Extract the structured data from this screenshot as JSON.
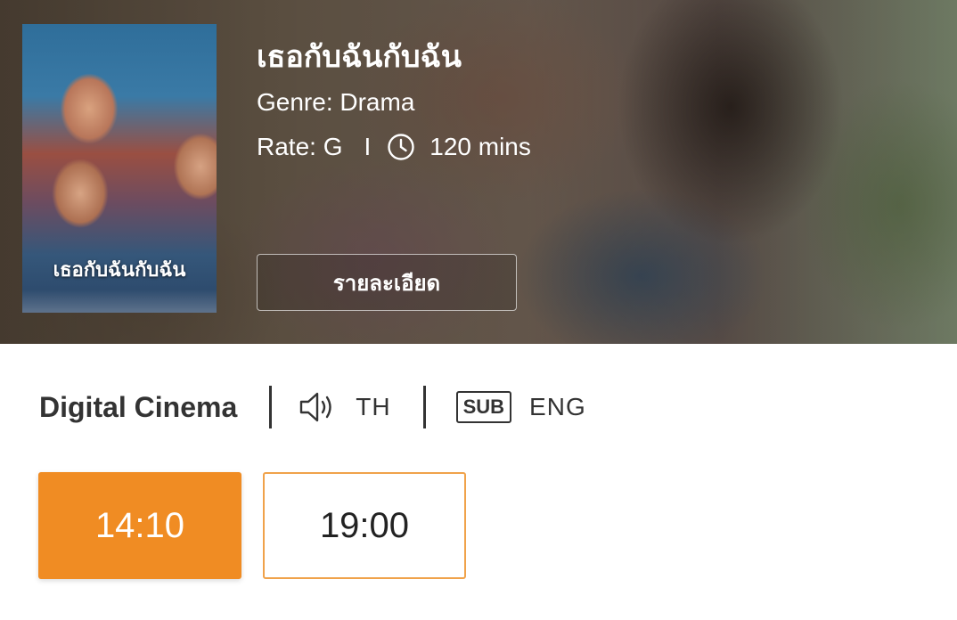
{
  "movie": {
    "title": "เธอกับฉันกับฉัน",
    "genre_label": "Genre: Drama",
    "rate_label": "Rate: G",
    "separator": "I",
    "duration": "120 mins",
    "poster_title": "เธอกับฉันกับฉัน",
    "details_button": "รายละเอียด"
  },
  "format": {
    "name": "Digital Cinema",
    "audio_language": "TH",
    "subtitle_badge": "SUB",
    "subtitle_language": "ENG"
  },
  "showtimes": [
    {
      "time": "14:10",
      "selected": true
    },
    {
      "time": "19:00",
      "selected": false
    }
  ],
  "colors": {
    "accent": "#f08c23",
    "accent_border": "#f0a24a",
    "text_dark": "#333333"
  },
  "icons": {
    "clock": "clock-icon",
    "speaker": "speaker-icon"
  }
}
